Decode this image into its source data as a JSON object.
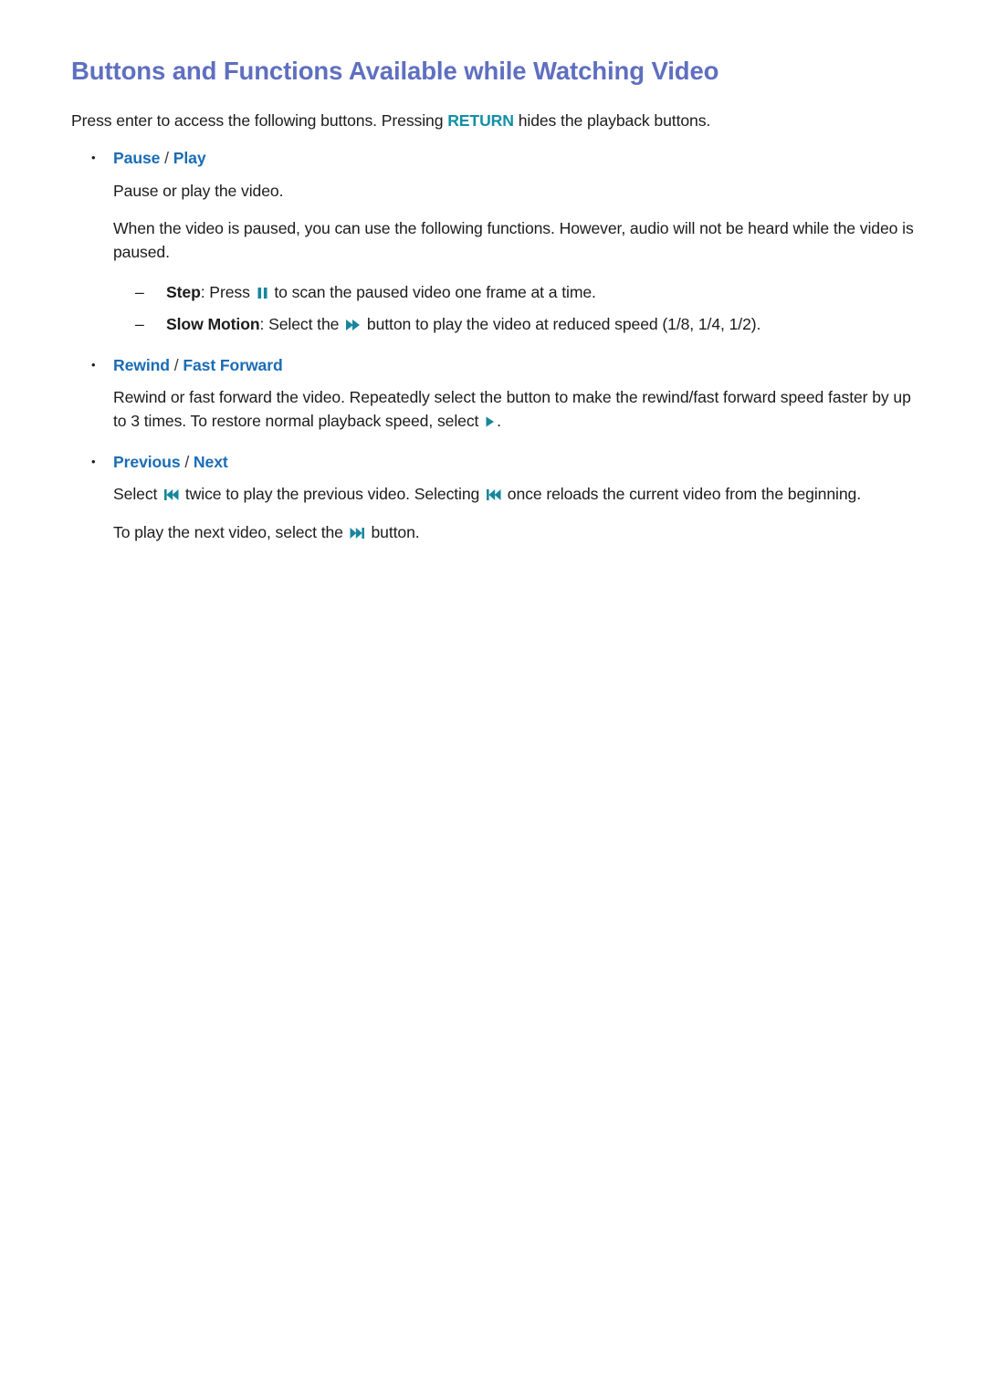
{
  "document": {
    "title": "Buttons and Functions Available while Watching Video",
    "title_color": "#5f6fc0",
    "body_color": "#1c1c1c",
    "link_color": "#1a6cb5",
    "keyword_color": "#1190a6",
    "icon_color": "#17869c"
  },
  "intro": {
    "part1": "Press enter to access the following buttons. Pressing ",
    "keyword": "RETURN",
    "part2": " hides the playback buttons."
  },
  "sections": [
    {
      "bullet": "•",
      "title_a": "Pause",
      "separator": " / ",
      "title_b": "Play",
      "paragraph1": "Pause or play the video.",
      "paragraph2": "When the video is paused, you can use the following functions. However, audio will not be heard while the video is paused.",
      "subitems": [
        {
          "dash": "–",
          "label": "Step",
          "text_before": ": Press ",
          "icon": "pause-icon",
          "text_after": " to scan the paused video one frame at a time."
        },
        {
          "dash": "–",
          "label": "Slow Motion",
          "text_before": ": Select the ",
          "icon": "fast-forward-icon",
          "text_after": " button to play the video at reduced speed (1/8, 1/4, 1/2)."
        }
      ]
    },
    {
      "bullet": "•",
      "title_a": "Rewind",
      "separator": " / ",
      "title_b": "Fast Forward",
      "paragraph1_before": "Rewind or fast forward the video. Repeatedly select the button to make the rewind/fast forward speed faster by up to 3 times. To restore normal playback speed, select ",
      "paragraph1_icon": "play-icon",
      "paragraph1_after": "."
    },
    {
      "bullet": "•",
      "title_a": "Previous",
      "separator": " / ",
      "title_b": "Next",
      "paragraph1_a": "Select ",
      "paragraph1_icon1": "previous-track-icon",
      "paragraph1_b": " twice to play the previous video. Selecting ",
      "paragraph1_icon2": "previous-track-icon",
      "paragraph1_c": " once reloads the current video from the beginning.",
      "paragraph2_a": "To play the next video, select the ",
      "paragraph2_icon": "next-track-icon",
      "paragraph2_b": " button."
    }
  ]
}
